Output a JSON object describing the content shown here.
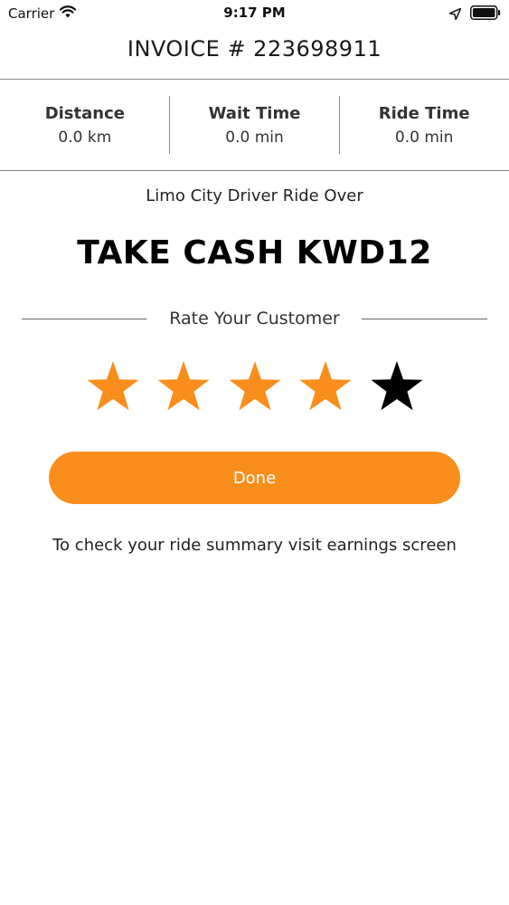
{
  "status_bar": {
    "carrier": "Carrier",
    "time": "9:17 PM",
    "icons": [
      "wifi-icon",
      "location-arrow-icon",
      "battery-icon"
    ]
  },
  "header": {
    "invoice_title": "INVOICE # 223698911"
  },
  "stats": [
    {
      "label": "Distance",
      "value": "0.0 km"
    },
    {
      "label": "Wait Time",
      "value": "0.0 min"
    },
    {
      "label": "Ride Time",
      "value": "0.0 min"
    }
  ],
  "ride": {
    "status_text": "Limo City Driver Ride Over",
    "cash_text": "TAKE CASH KWD12"
  },
  "rating": {
    "title": "Rate Your Customer",
    "max_stars": 5,
    "value": 4,
    "filled_color": "#F98E1C",
    "empty_color": "#000000"
  },
  "done_button": {
    "label": "Done",
    "color": "#F98E1C"
  },
  "footer": {
    "summary_note": "To check your ride summary visit earnings screen"
  }
}
